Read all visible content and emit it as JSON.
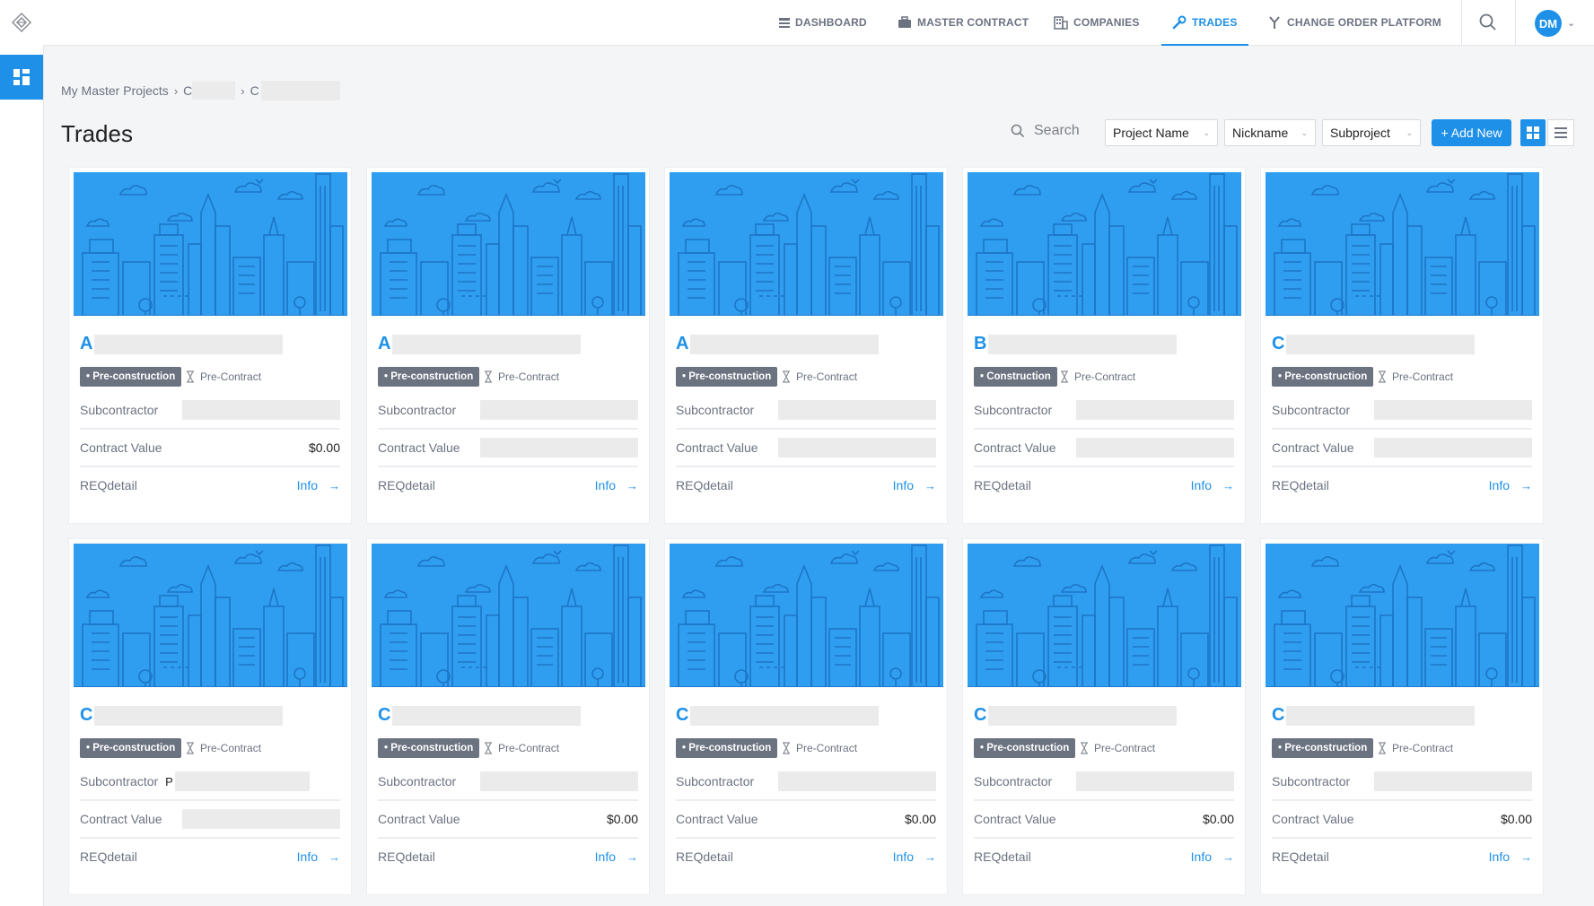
{
  "nav": {
    "items": [
      {
        "label": "DASHBOARD",
        "icon": "dashboard-icon"
      },
      {
        "label": "MASTER CONTRACT",
        "icon": "briefcase-icon"
      },
      {
        "label": "COMPANIES",
        "icon": "building-icon"
      },
      {
        "label": "TRADES",
        "icon": "wrench-icon",
        "active": true
      },
      {
        "label": "CHANGE ORDER PLATFORM",
        "icon": "fork-icon"
      }
    ],
    "avatar": "DM"
  },
  "breadcrumb": [
    "My Master Projects",
    "C",
    "C"
  ],
  "page_title": "Trades",
  "toolbar": {
    "search_label": "Search",
    "filters": [
      "Project Name",
      "Nickname",
      "Subproject"
    ],
    "add_label": "+ Add New"
  },
  "card_labels": {
    "subcontractor": "Subcontractor",
    "contract_value": "Contract Value",
    "req": "REQdetail",
    "info": "Info"
  },
  "cards": [
    {
      "title": "A",
      "phase": "• Pre-construction",
      "status": "Pre-Contract",
      "subcontractor": "",
      "contract_value": "$0.00"
    },
    {
      "title": "A",
      "phase": "• Pre-construction",
      "status": "Pre-Contract",
      "subcontractor": "",
      "contract_value": ""
    },
    {
      "title": "A",
      "phase": "• Pre-construction",
      "status": "Pre-Contract",
      "subcontractor": "",
      "contract_value": ""
    },
    {
      "title": "B",
      "phase": "• Construction",
      "status": "Pre-Contract",
      "subcontractor": "",
      "contract_value": ""
    },
    {
      "title": "C",
      "phase": "• Pre-construction",
      "status": "Pre-Contract",
      "subcontractor": "",
      "contract_value": ""
    },
    {
      "title": "C",
      "phase": "• Pre-construction",
      "status": "Pre-Contract",
      "subcontractor": "P",
      "contract_value": ""
    },
    {
      "title": "C",
      "phase": "• Pre-construction",
      "status": "Pre-Contract",
      "subcontractor": "",
      "contract_value": "$0.00"
    },
    {
      "title": "C",
      "phase": "• Pre-construction",
      "status": "Pre-Contract",
      "subcontractor": "",
      "contract_value": "$0.00"
    },
    {
      "title": "C",
      "phase": "• Pre-construction",
      "status": "Pre-Contract",
      "subcontractor": "",
      "contract_value": "$0.00"
    },
    {
      "title": "C",
      "phase": "• Pre-construction",
      "status": "Pre-Contract",
      "subcontractor": "",
      "contract_value": "$0.00"
    }
  ],
  "colors": {
    "accent": "#1e90e8",
    "badge": "#6b7280",
    "card_image": "#2f9ef0"
  }
}
